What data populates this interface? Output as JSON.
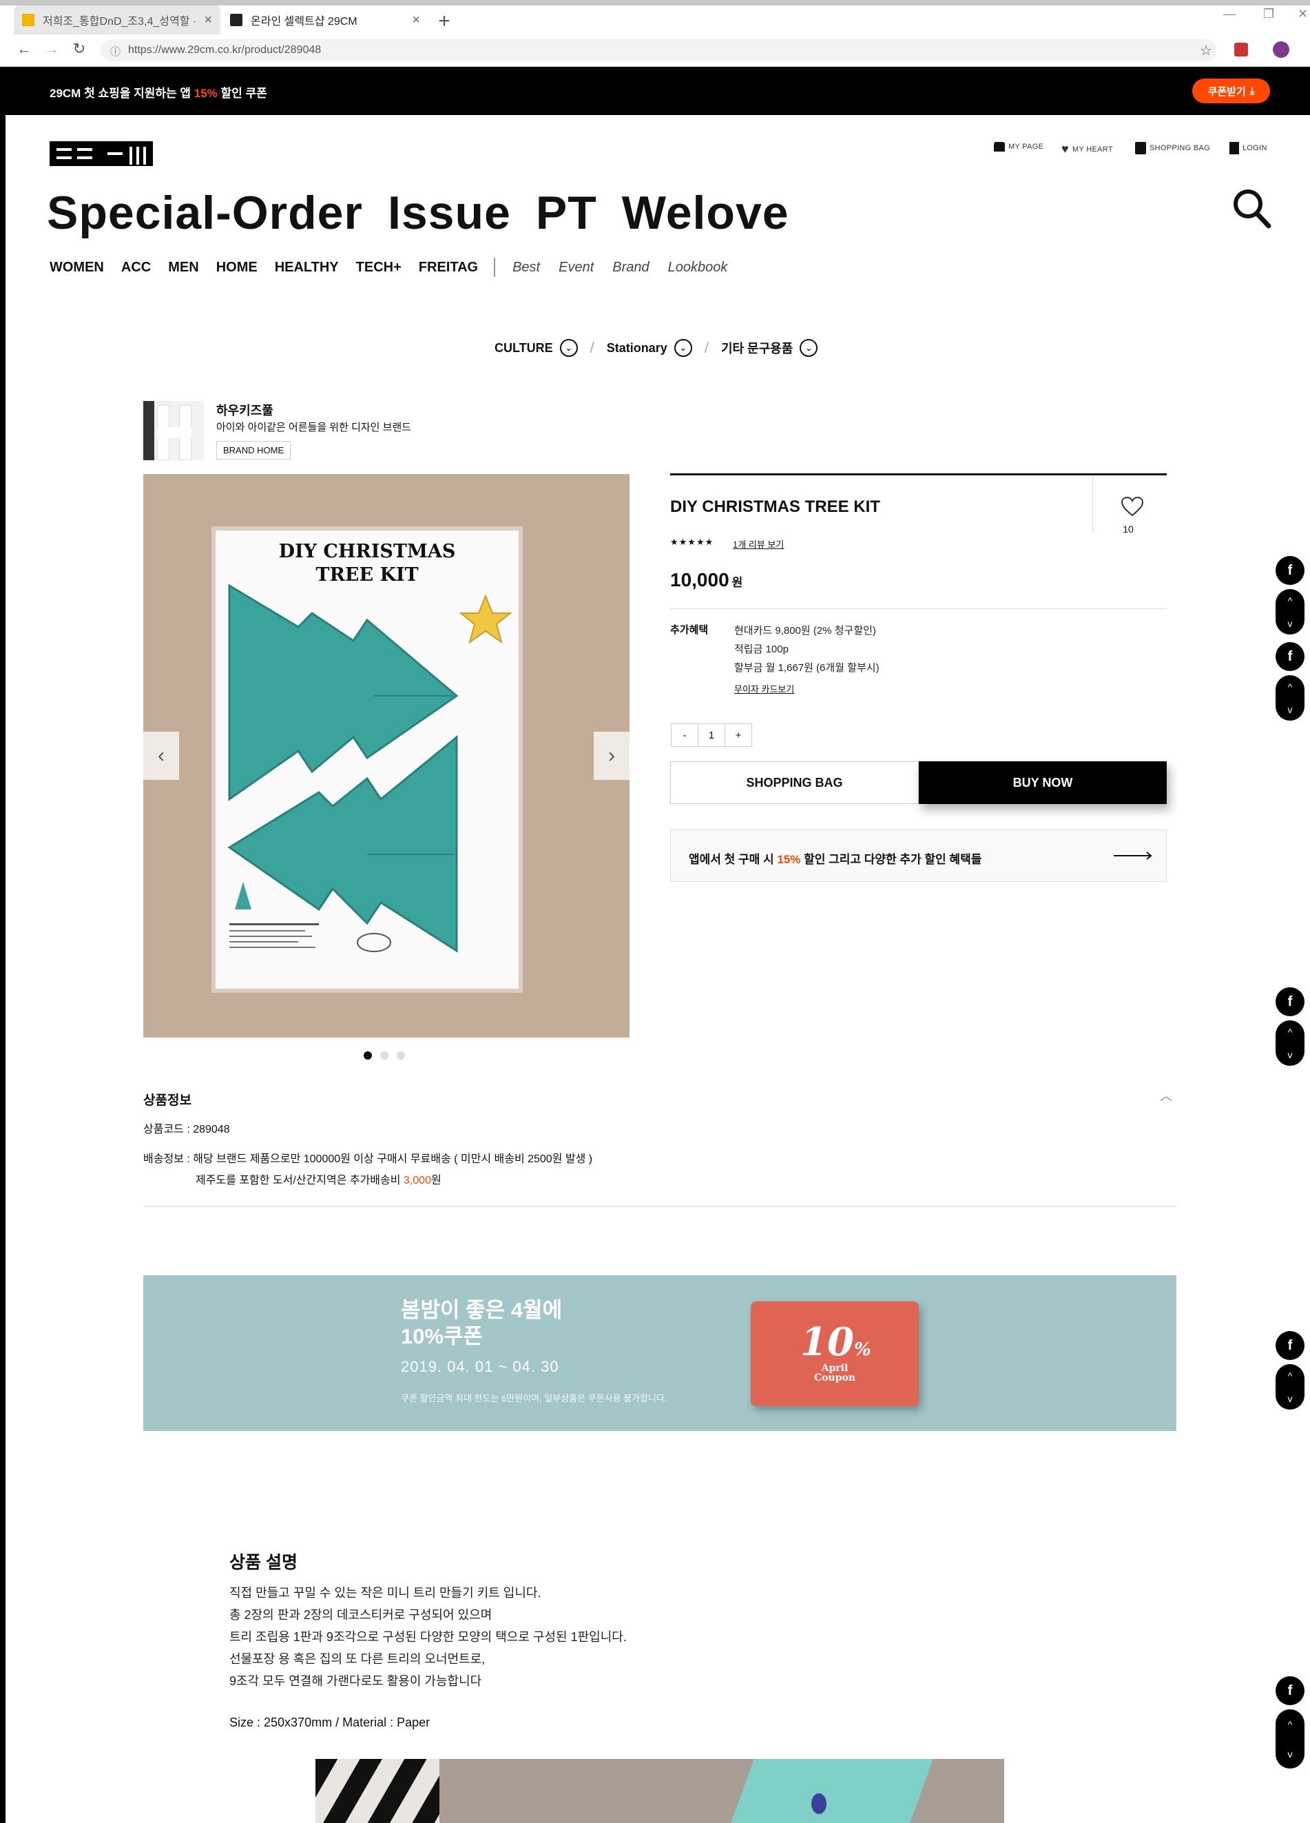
{
  "browser": {
    "tabs": [
      {
        "title": "저희조_통합DnD_조3,4_성역할 ·"
      },
      {
        "title": "온라인 셀렉트샵 29CM"
      }
    ],
    "new_tab": "+",
    "url": "https://www.29cm.co.kr/product/289048"
  },
  "promo_bar": {
    "text_before": "29CM 첫 쇼핑을 지원하는 앱 ",
    "highlight": "15%",
    "text_after": " 할인 쿠폰",
    "coupon_button": "쿠폰받기"
  },
  "header": {
    "utility_links": [
      "MY PAGE",
      "MY HEART",
      "SHOPPING BAG",
      "LOGIN"
    ],
    "big_nav": [
      "Special-Order",
      "Issue",
      "PT",
      "Welove"
    ],
    "categories": [
      "WOMEN",
      "ACC",
      "MEN",
      "HOME",
      "HEALTHY",
      "TECH+",
      "FREITAG"
    ],
    "secondary": [
      "Best",
      "Event",
      "Brand",
      "Lookbook"
    ]
  },
  "breadcrumb": [
    "CULTURE",
    "Stationary",
    "기타 문구용품"
  ],
  "brand": {
    "name": "하우키즈풀",
    "tagline": "아이와 아이같은 어른들을 위한 디자인 브랜드",
    "home_button": "BRAND HOME"
  },
  "image": {
    "kit_title_line1": "DIY CHRISTMAS",
    "kit_title_line2": "TREE KIT",
    "slide_count": 3,
    "active_slide": 1
  },
  "product": {
    "name": "DIY CHRISTMAS TREE KIT",
    "heart_count": "10",
    "stars": "★★★★★",
    "review_link": "1개 리뷰 보기",
    "price": "10,000",
    "price_unit": "원",
    "benefit_label": "추가혜택",
    "benefits": [
      "현대카드 9,800원 (2% 청구할인)",
      "적립금 100p",
      "할부금 월 1,667원 (6개월 할부시)"
    ],
    "card_link": "무이자 카드보기",
    "qty_minus": "-",
    "qty_value": "1",
    "qty_plus": "+",
    "bag_button": "SHOPPING BAG",
    "buy_button": "BUY NOW",
    "app_text_before": "앱에서 첫 구매 시 ",
    "app_highlight": "15%",
    "app_text_after": " 할인 그리고 다양한 추가 할인 혜택들"
  },
  "info": {
    "title": "상품정보",
    "code": "상품코드 : 289048",
    "shipping_line1": "배송정보 : 해당 브랜드 제품으로만 100000원 이상 구매시 무료배송 ( 미만시 배송비 2500원 발생 )",
    "shipping_line2_before": "제주도를 포함한 도서/산간지역은 추가배송비 ",
    "shipping_line2_highlight": "3,000",
    "shipping_line2_after": "원"
  },
  "banner": {
    "title": "봄밤이 좋은 4월에\n10%쿠폰",
    "date": "2019. 04. 01 ~ 04. 30",
    "note": "쿠폰 할인금액 최대 한도는 6만원이며, 일부상품은 쿠폰사용 불가합니다.",
    "card_percent": "10",
    "card_percent_sign": "%",
    "card_line1": "April",
    "card_line2": "Coupon"
  },
  "description": {
    "title": "상품 설명",
    "lines": [
      "직접 만들고 꾸밀 수 있는 작은 미니 트리 만들기 키트 입니다.",
      "총 2장의 판과 2장의 데코스티커로 구성되어 있으며",
      "트리 조립용 1판과 9조각으로 구성된 다양한 모양의 택으로 구성된 1판입니다.",
      "선물포장 용 혹은 집의 또 다른 트리의 오너먼트로,",
      "9조각 모두 연결해 가랜다로도 활용이 가능합니다"
    ],
    "size": "Size : 250x370mm / Material : Paper"
  },
  "colors": {
    "accent": "#ff4800",
    "teal": "#3aa39b",
    "banner_bg": "#a3c6c8",
    "coupon": "#e06453"
  },
  "side_widget": {
    "fb_label": "f",
    "up": "^",
    "down": "v"
  }
}
